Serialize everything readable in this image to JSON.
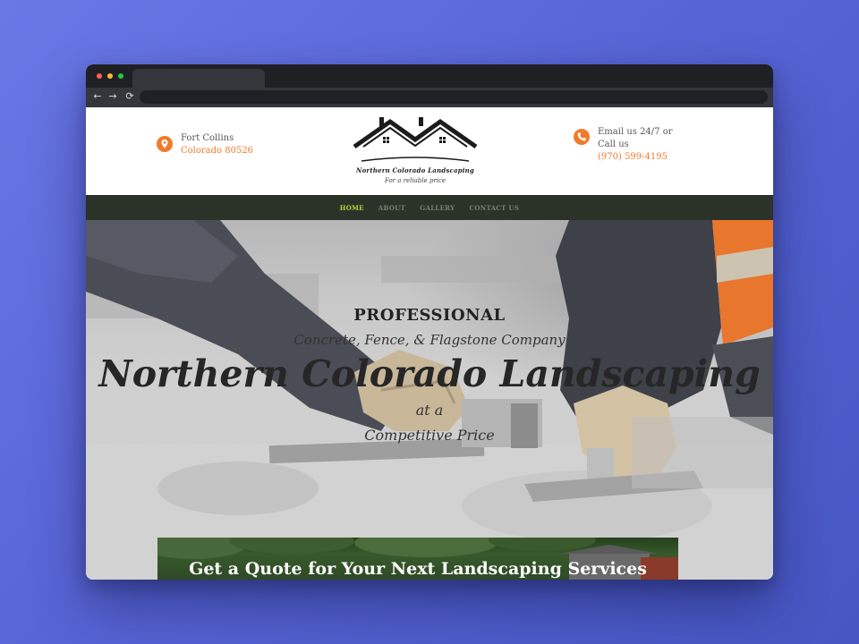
{
  "browser": {
    "icons": {
      "back": "arrow-left-icon",
      "forward": "arrow-right-icon",
      "reload": "reload-icon"
    }
  },
  "header": {
    "location": {
      "line1": "Fort Collins",
      "line2": "Colorado 80526"
    },
    "logo": {
      "title": "Northern Colorado Landscaping",
      "tagline": "For a reliable price"
    },
    "contact": {
      "line1": "Email us 24/7 or",
      "line2": "Call us",
      "phone": "(970) 599-4195"
    },
    "accent_color": "#f07b2b"
  },
  "nav": {
    "items": [
      {
        "label": "HOME",
        "active": true
      },
      {
        "label": "ABOUT",
        "active": false
      },
      {
        "label": "GALLERY",
        "active": false
      },
      {
        "label": "CONTACT US",
        "active": false
      }
    ],
    "active_color": "#b7d436"
  },
  "hero": {
    "kicker": "PROFESSIONAL",
    "subtitle": "Concrete, Fence, & Flagstone Company",
    "title": "Northern Colorado Landscaping",
    "line_a": "at a",
    "line_b": "Competitive Price"
  },
  "quote": {
    "heading": "Get a Quote for Your Next Landscaping Services"
  }
}
